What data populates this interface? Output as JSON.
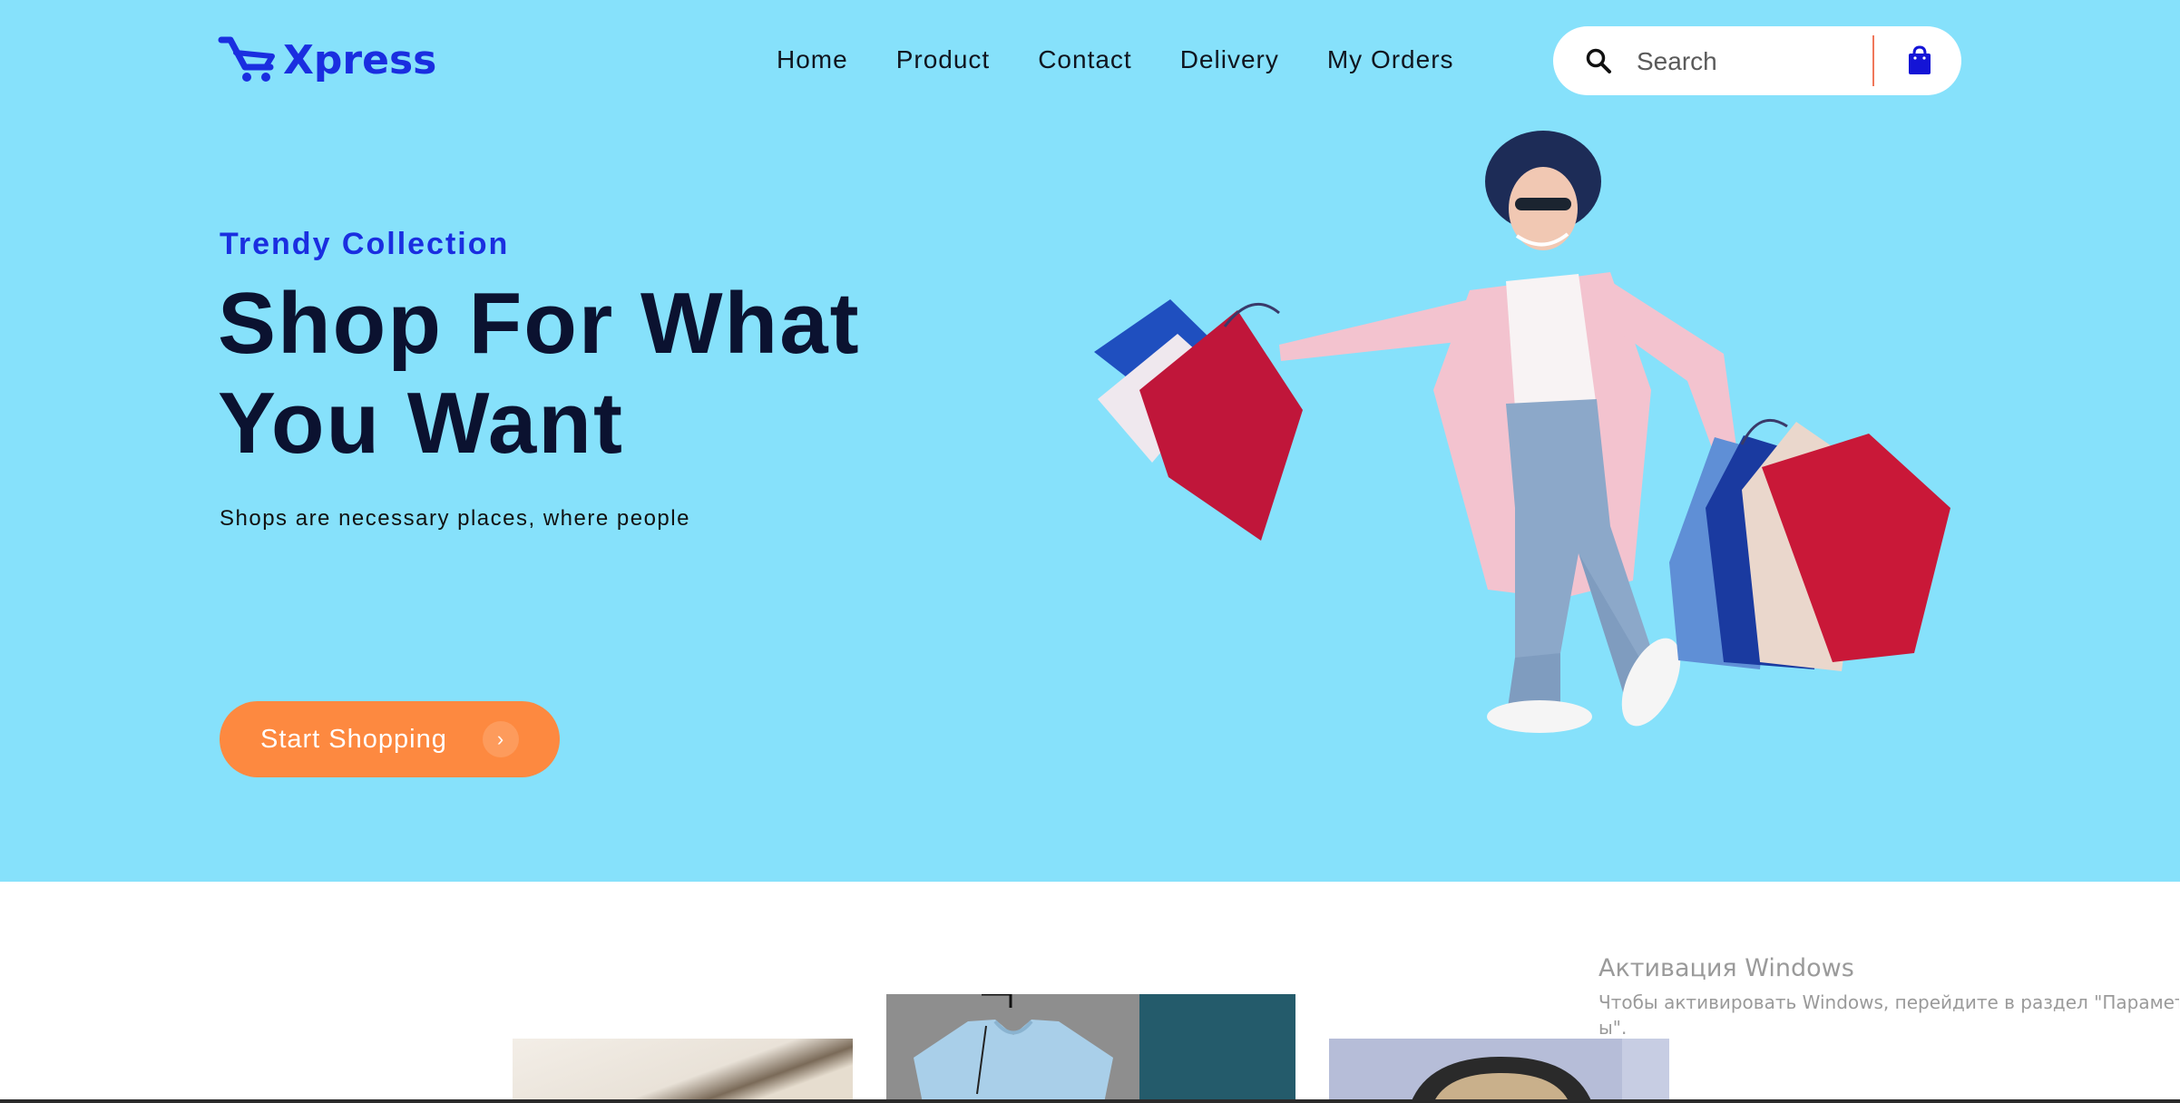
{
  "brand": {
    "name": "Xpress",
    "color": "#1a2ee0"
  },
  "nav": {
    "items": [
      "Home",
      "Product",
      "Contact",
      "Delivery",
      "My Orders"
    ]
  },
  "search": {
    "placeholder": "Search",
    "icon": "search-icon",
    "cart_icon": "shopping-bag-icon"
  },
  "hero": {
    "eyebrow": "Trendy Collection",
    "headline_line1": "Shop For What",
    "headline_line2": "You Want",
    "subtext": "Shops are necessary places, where people",
    "cta_label": "Start Shopping",
    "cta_arrow": "›",
    "background": "#86e1fb",
    "cta_color": "#fd8940"
  },
  "overlay": {
    "title": "Активация Windows",
    "line1": "Чтобы активировать Windows, перейдите в раздел \"Параметры\".",
    "line2": "ы\"."
  }
}
